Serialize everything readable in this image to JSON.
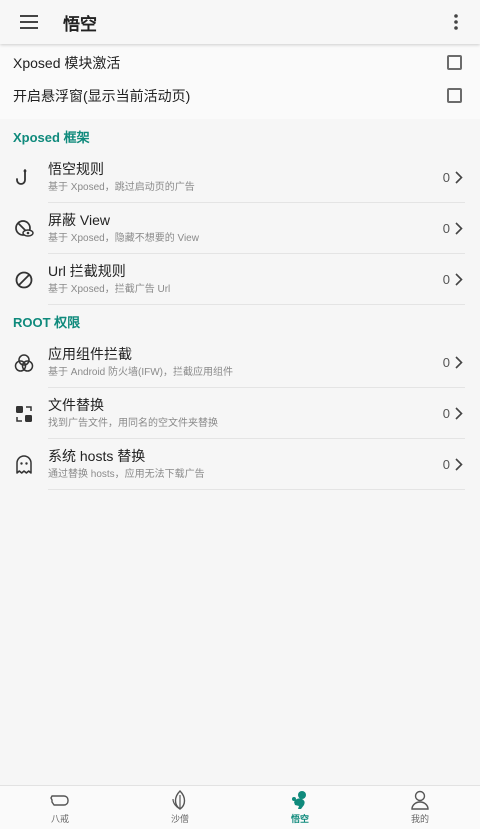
{
  "header": {
    "title": "悟空"
  },
  "toggles": [
    {
      "label": "Xposed 模块激活",
      "checked": false
    },
    {
      "label": "开启悬浮窗(显示当前活动页)",
      "checked": false
    }
  ],
  "sections": [
    {
      "title": "Xposed 框架",
      "items": [
        {
          "title": "悟空规则",
          "subtitle": "基于 Xposed，跳过启动页的广告",
          "count": "0",
          "icon": "hook-icon"
        },
        {
          "title": "屏蔽 View",
          "subtitle": "基于 Xposed，隐藏不想要的 View",
          "count": "0",
          "icon": "eye-block-icon"
        },
        {
          "title": "Url 拦截规则",
          "subtitle": "基于 Xposed，拦截广告 Url",
          "count": "0",
          "icon": "block-icon"
        }
      ]
    },
    {
      "title": "ROOT 权限",
      "items": [
        {
          "title": "应用组件拦截",
          "subtitle": "基于 Android 防火墙(IFW)，拦截应用组件",
          "count": "0",
          "icon": "circles-icon"
        },
        {
          "title": "文件替换",
          "subtitle": "找到广告文件，用同名的空文件夹替换",
          "count": "0",
          "icon": "swap-icon"
        },
        {
          "title": "系统 hosts 替换",
          "subtitle": "通过替换 hosts，应用无法下载广告",
          "count": "0",
          "icon": "ghost-icon"
        }
      ]
    }
  ],
  "bottom_nav": [
    {
      "label": "八戒",
      "icon": "pig-icon",
      "active": false
    },
    {
      "label": "沙僧",
      "icon": "leaf-icon",
      "active": false
    },
    {
      "label": "悟空",
      "icon": "monkey-icon",
      "active": true
    },
    {
      "label": "我的",
      "icon": "person-icon",
      "active": false
    }
  ],
  "colors": {
    "accent": "#0f8a7c",
    "text": "#222222",
    "subtext": "#8a8a8a"
  }
}
